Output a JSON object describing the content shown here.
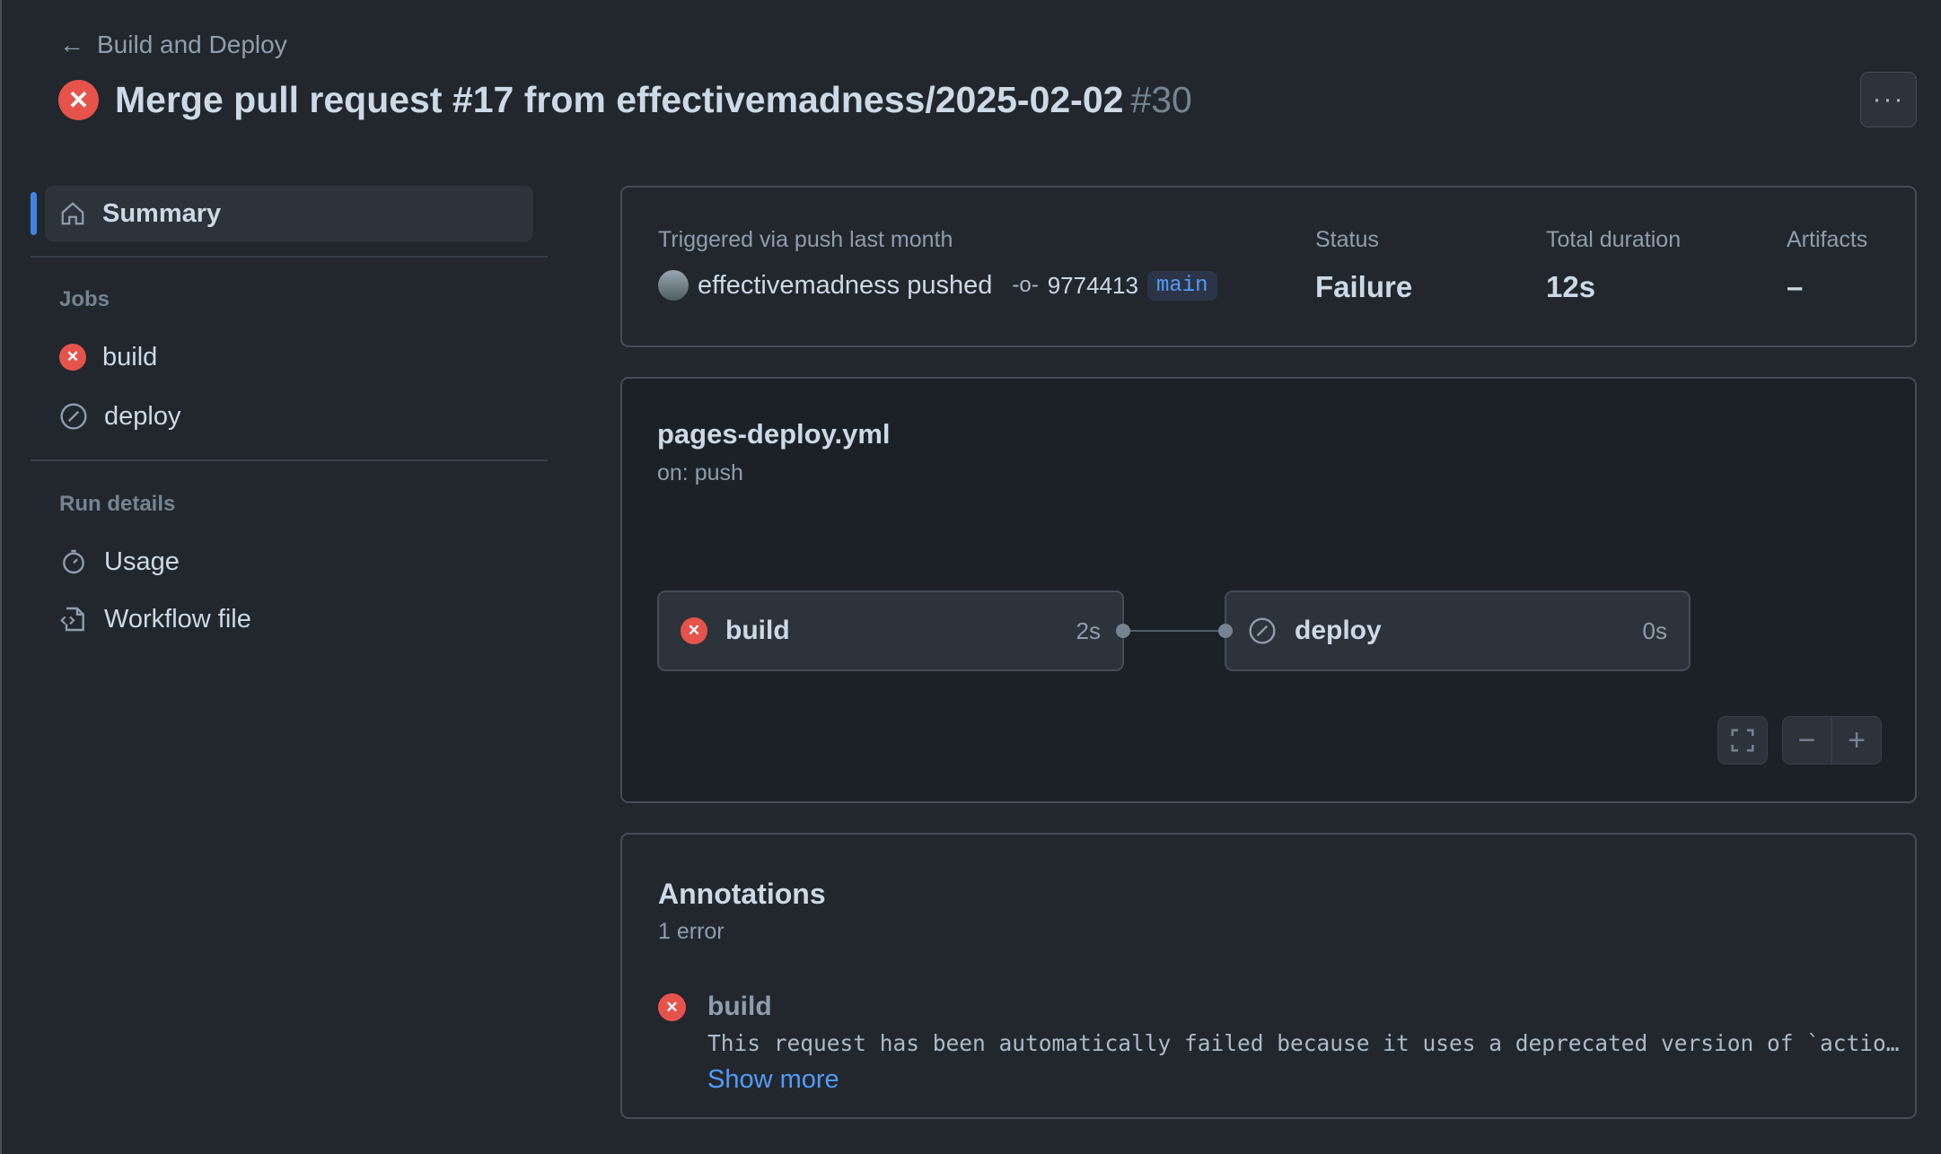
{
  "header": {
    "back_label": "Build and Deploy",
    "title": "Merge pull request #17 from effectivemadness/2025-02-02",
    "run_number": "#30",
    "menu_label": "···"
  },
  "sidebar": {
    "summary": "Summary",
    "jobs_heading": "Jobs",
    "jobs": [
      {
        "label": "build",
        "status": "failure"
      },
      {
        "label": "deploy",
        "status": "skipped"
      }
    ],
    "run_details_heading": "Run details",
    "usage": "Usage",
    "workflow_file": "Workflow file"
  },
  "summary_card": {
    "trigger": "Triggered via push last month",
    "actor": "effectivemadness pushed",
    "commit": "9774413",
    "branch": "main",
    "status_label": "Status",
    "status": "Failure",
    "duration_label": "Total duration",
    "duration": "12s",
    "artifacts_label": "Artifacts",
    "artifacts": "–"
  },
  "graph": {
    "file": "pages-deploy.yml",
    "trigger": "on: push",
    "nodes": [
      {
        "label": "build",
        "duration": "2s",
        "status": "failure"
      },
      {
        "label": "deploy",
        "duration": "0s",
        "status": "skipped"
      }
    ]
  },
  "annotations": {
    "title": "Annotations",
    "count": "1 error",
    "items": [
      {
        "job": "build",
        "message": "This request has been automatically failed because it uses a deprecated version of `actio…",
        "show_more": "Show more"
      }
    ]
  },
  "colors": {
    "background": "#22272e",
    "failure": "#e5534b",
    "link": "#539bf5",
    "accent": "#4184e4"
  }
}
